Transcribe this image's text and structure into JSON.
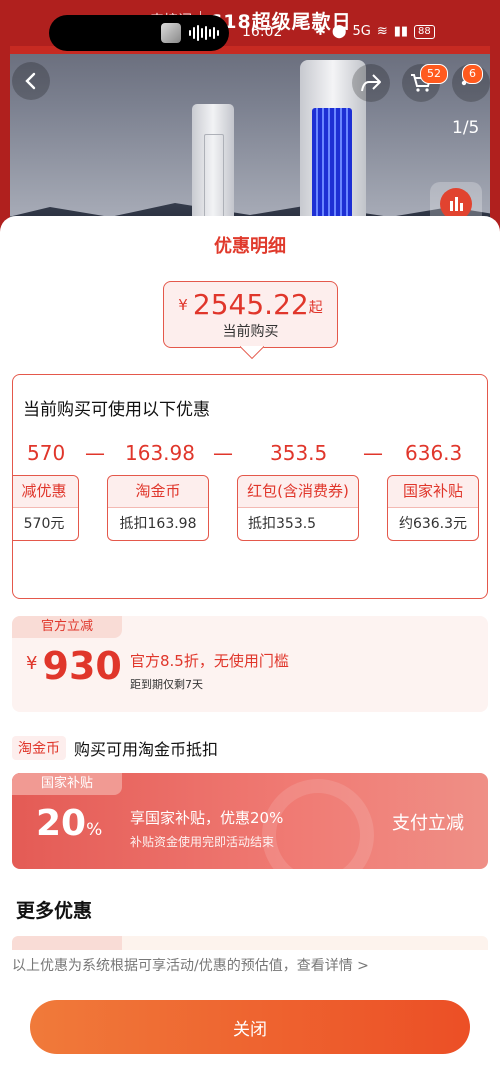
{
  "status_bar": {
    "time": "16:02",
    "icons": [
      "bluetooth-icon",
      "location-icon",
      "nfc-icon",
      "wifi-icon",
      "signal-icon",
      "battery-icon"
    ],
    "network": "5G",
    "battery": "88"
  },
  "banner": {
    "prefix": "来接词",
    "title": "618超级尾款日"
  },
  "nav": {
    "cart_badge": "52",
    "more_badge": "6",
    "pager": "1/5"
  },
  "sheet": {
    "title": "优惠明细",
    "price": {
      "currency": "¥",
      "value": "2545.22",
      "suffix": "起",
      "label": "当前购买"
    },
    "panel": {
      "heading": "当前购买可使用以下优惠",
      "amounts": [
        "570",
        "163.98",
        "353.5",
        "636.3"
      ],
      "operator": "—",
      "chips": [
        {
          "name": "减优惠",
          "value": "570元"
        },
        {
          "name": "淘金币",
          "value": "抵扣163.98"
        },
        {
          "name": "红包(含消费券)",
          "value": "抵扣353.5"
        },
        {
          "name": "国家补贴",
          "value": "约636.3元"
        }
      ]
    },
    "official": {
      "tag": "官方立减",
      "currency": "¥",
      "amount": "930",
      "desc": "官方8.5折，无使用门槛",
      "sub": "距到期仅剩7天"
    },
    "taojin": {
      "tag": "淘金币",
      "text": "购买可用淘金币抵扣"
    },
    "subsidy": {
      "tag": "国家补贴",
      "percent": "20",
      "unit": "%",
      "desc": "享国家补贴，优惠20%",
      "sub": "补贴资金使用完即活动结束",
      "action": "支付立减"
    },
    "more_title": "更多优惠",
    "more_peek_tag": "店铺满减",
    "disclaimer": "以上优惠为系统根据可享活动/优惠的预估值，查看详情 >",
    "close_label": "关闭"
  },
  "colors": {
    "accent": "#e0362b",
    "button_start": "#f07a3a",
    "button_end": "#ec4f26"
  }
}
